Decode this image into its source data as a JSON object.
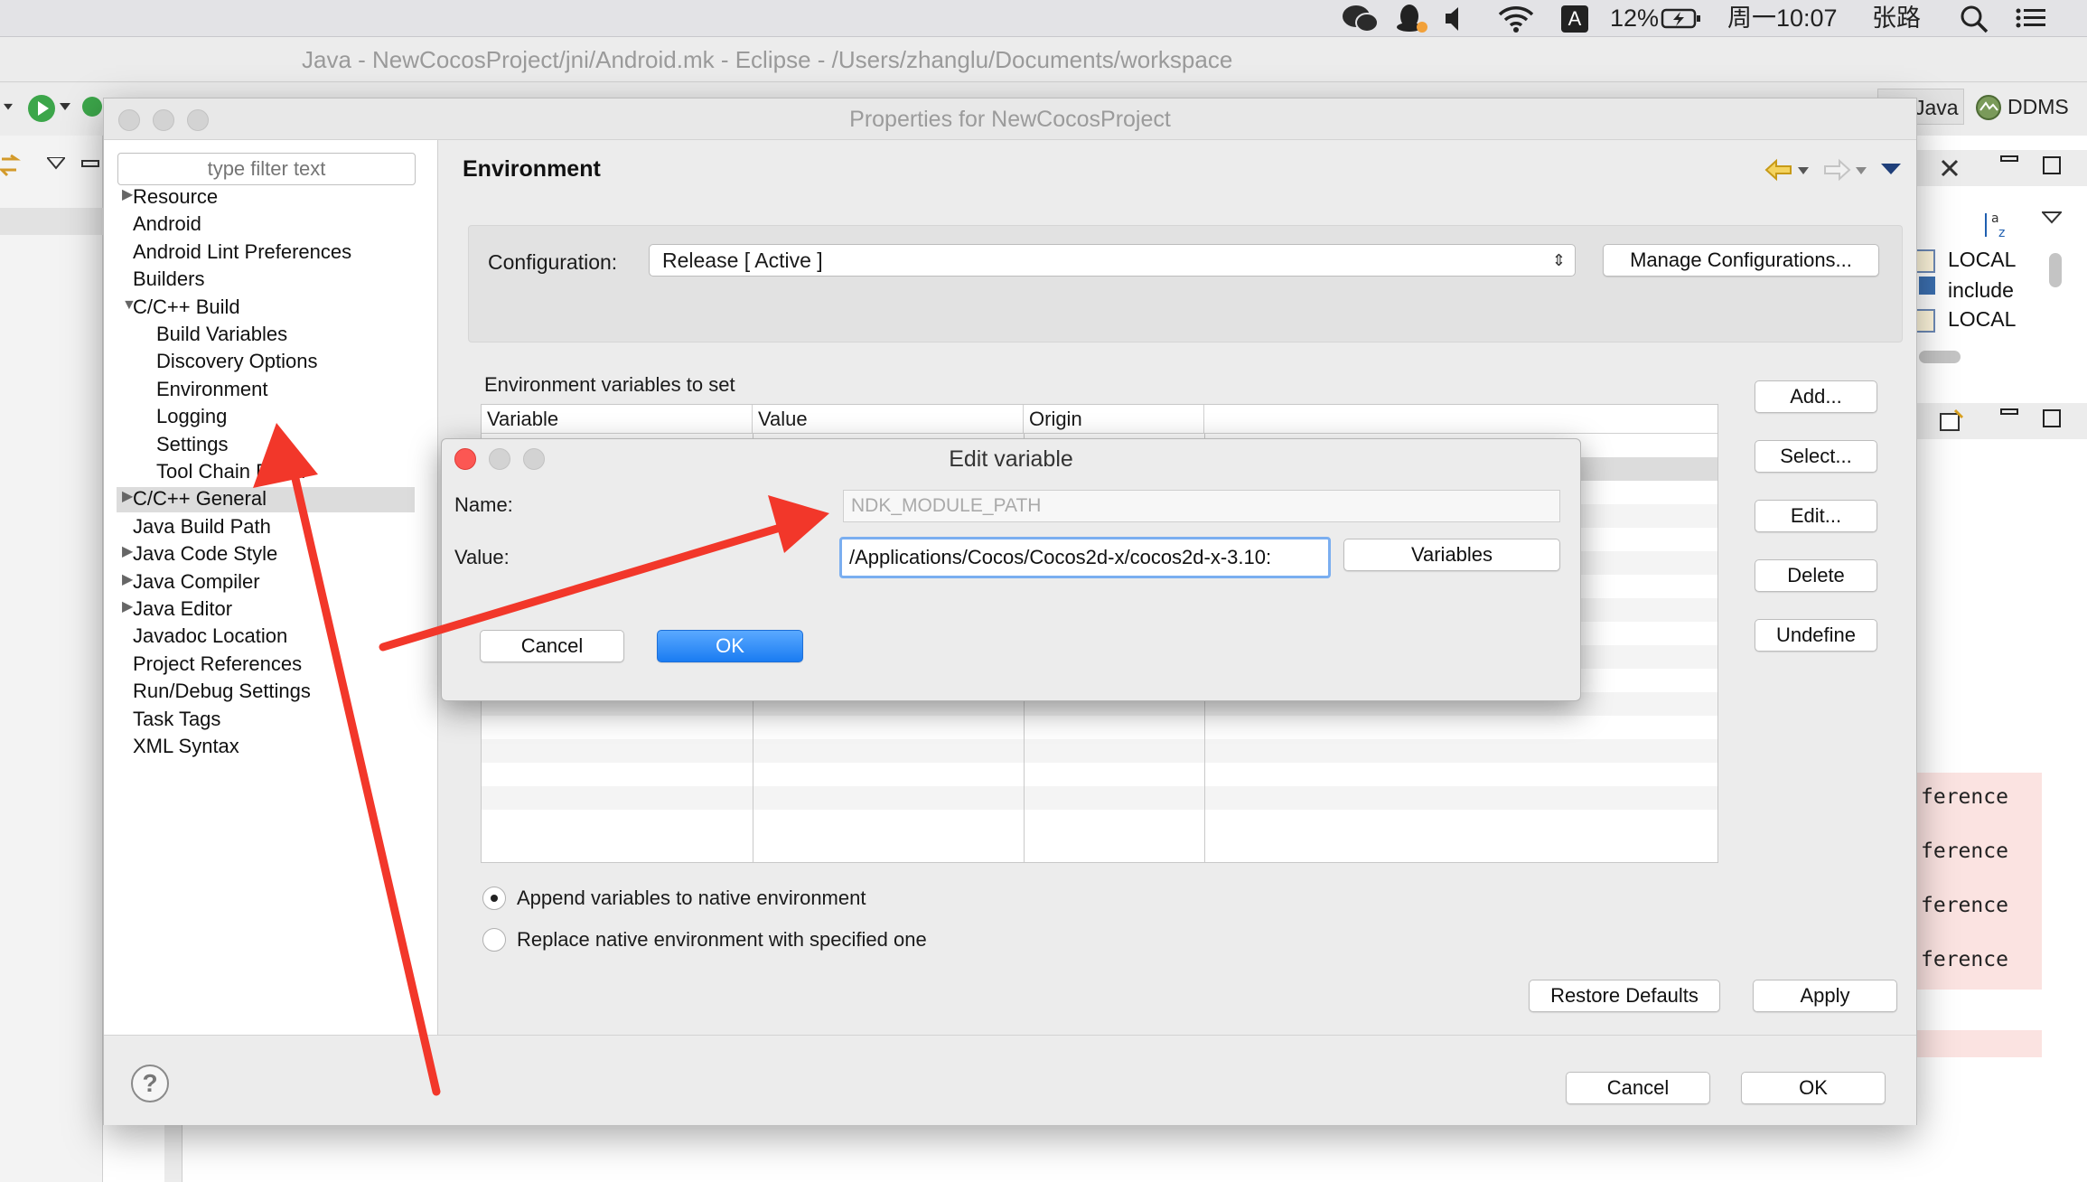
{
  "menubar": {
    "battery": "12%",
    "clock": "周一10:07",
    "user": "张路",
    "input_source": "A"
  },
  "eclipse": {
    "window_title": "Java - NewCocosProject/jni/Android.mk - Eclipse - /Users/zhanglu/Documents/workspace",
    "perspective_java": "Java",
    "perspective_ddms": "DDMS",
    "outline_rows": [
      "LOCAL",
      "include",
      "LOCAL"
    ],
    "editor_fragments": [
      "ference",
      "ference",
      "ference",
      "ference"
    ]
  },
  "properties": {
    "title": "Properties for NewCocosProject",
    "filter_placeholder": "type filter text",
    "tree": [
      {
        "label": "Resource",
        "arrow": "▶",
        "level": 0
      },
      {
        "label": "Android",
        "arrow": "",
        "level": 0
      },
      {
        "label": "Android Lint Preferences",
        "arrow": "",
        "level": 0
      },
      {
        "label": "Builders",
        "arrow": "",
        "level": 0
      },
      {
        "label": "C/C++ Build",
        "arrow": "▼",
        "level": 0
      },
      {
        "label": "Build Variables",
        "arrow": "",
        "level": 1
      },
      {
        "label": "Discovery Options",
        "arrow": "",
        "level": 1
      },
      {
        "label": "Environment",
        "arrow": "",
        "level": 1
      },
      {
        "label": "Logging",
        "arrow": "",
        "level": 1
      },
      {
        "label": "Settings",
        "arrow": "",
        "level": 1
      },
      {
        "label": "Tool Chain Editor",
        "arrow": "",
        "level": 1
      },
      {
        "label": "C/C++ General",
        "arrow": "▶",
        "level": 0
      },
      {
        "label": "Java Build Path",
        "arrow": "",
        "level": 0
      },
      {
        "label": "Java Code Style",
        "arrow": "▶",
        "level": 0
      },
      {
        "label": "Java Compiler",
        "arrow": "▶",
        "level": 0
      },
      {
        "label": "Java Editor",
        "arrow": "▶",
        "level": 0
      },
      {
        "label": "Javadoc Location",
        "arrow": "",
        "level": 0
      },
      {
        "label": "Project References",
        "arrow": "",
        "level": 0
      },
      {
        "label": "Run/Debug Settings",
        "arrow": "",
        "level": 0
      },
      {
        "label": "Task Tags",
        "arrow": "",
        "level": 0
      },
      {
        "label": "XML Syntax",
        "arrow": "",
        "level": 0
      }
    ],
    "page_title": "Environment",
    "configuration_label": "Configuration:",
    "configuration_value": "Release  [ Active ]",
    "manage_configurations": "Manage Configurations...",
    "env_section_label": "Environment variables to set",
    "columns": [
      "Variable",
      "Value",
      "Origin"
    ],
    "side_buttons": [
      "Add...",
      "Select...",
      "Edit...",
      "Delete",
      "Undefine"
    ],
    "radio_append": "Append variables to native environment",
    "radio_replace": "Replace native environment with specified one",
    "radio_selected": "append",
    "restore_defaults": "Restore Defaults",
    "apply": "Apply",
    "cancel": "Cancel",
    "ok": "OK",
    "help_glyph": "?"
  },
  "edit_variable": {
    "title": "Edit variable",
    "name_label": "Name:",
    "name_value": "NDK_MODULE_PATH",
    "value_label": "Value:",
    "value_value": "/Applications/Cocos/Cocos2d-x/cocos2d-x-3.10:",
    "variables_button": "Variables",
    "cancel": "Cancel",
    "ok": "OK"
  },
  "colors": {
    "annotation_red": "#f2372a",
    "accent_blue": "#1a7cf2",
    "close_red": "#fc5753"
  }
}
